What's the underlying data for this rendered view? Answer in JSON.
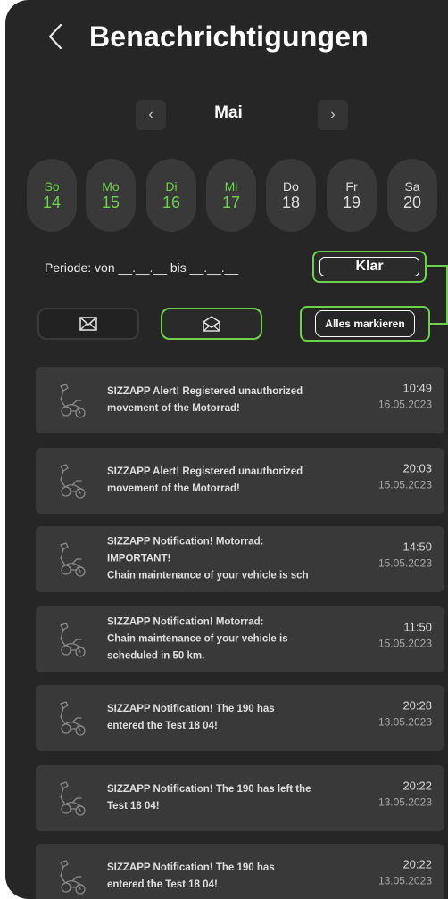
{
  "header": {
    "title": "Benachrichtigungen",
    "back_icon": "chevron-left-icon"
  },
  "calendar": {
    "month": "Mai",
    "days": [
      {
        "name": "So",
        "num": "14",
        "active": true
      },
      {
        "name": "Mo",
        "num": "15",
        "active": true
      },
      {
        "name": "Di",
        "num": "16",
        "active": true
      },
      {
        "name": "Mi",
        "num": "17",
        "active": true
      },
      {
        "name": "Do",
        "num": "18",
        "active": false
      },
      {
        "name": "Fr",
        "num": "19",
        "active": false
      },
      {
        "name": "Sa",
        "num": "20",
        "active": false
      }
    ]
  },
  "filter": {
    "periode_label": "Periode: von __.__.__ bis __.__.__",
    "klar_label": "Klar",
    "mark_all_label": "Alles markieren"
  },
  "colors": {
    "accent": "#6ed14b",
    "background": "#262626",
    "card": "#393939"
  },
  "notifications": [
    {
      "lines": [
        "SIZZAPP Alert! Registered unauthorized",
        "movement of the Motorrad!"
      ],
      "time": "10:49",
      "date": "16.05.2023"
    },
    {
      "lines": [
        "SIZZAPP Alert! Registered unauthorized",
        "movement of the Motorrad!"
      ],
      "time": "20:03",
      "date": "15.05.2023"
    },
    {
      "lines": [
        "SIZZAPP Notification! Motorrad:",
        "IMPORTANT!",
        "Chain maintenance of your vehicle is sch"
      ],
      "time": "14:50",
      "date": "15.05.2023"
    },
    {
      "lines": [
        "SIZZAPP Notification! Motorrad:",
        "Chain maintenance of your vehicle is",
        "scheduled in 50 km."
      ],
      "time": "11:50",
      "date": "15.05.2023"
    },
    {
      "lines": [
        "SIZZAPP Notification! The 190 has",
        "entered the Test 18 04!"
      ],
      "time": "20:28",
      "date": "13.05.2023"
    },
    {
      "lines": [
        "SIZZAPP Notification! The 190 has left the",
        "Test 18 04!"
      ],
      "time": "20:22",
      "date": "13.05.2023"
    },
    {
      "lines": [
        "SIZZAPP Notification! The 190 has",
        "entered the Test 18 04!"
      ],
      "time": "20:22",
      "date": "13.05.2023"
    }
  ]
}
